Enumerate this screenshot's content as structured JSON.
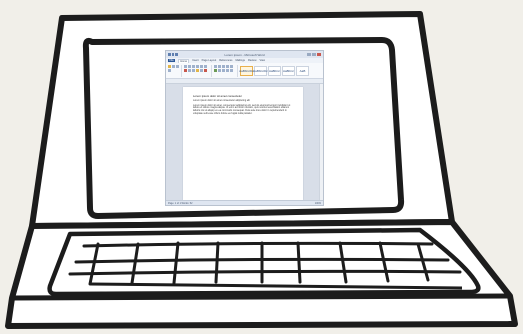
{
  "window": {
    "title": "Lorem ipsum - Microsoft Word",
    "tabs": [
      "File",
      "Home",
      "Insert",
      "Page Layout",
      "References",
      "Mailings",
      "Review",
      "View"
    ],
    "active_tab": "Home"
  },
  "ribbon": {
    "styles": [
      "AaBbCcDc",
      "AaBbCcDc",
      "AaBbCc",
      "AaBbCc",
      "AaB"
    ]
  },
  "document": {
    "heading": "Lorem ipsum dolor sit amet consectetur",
    "subheading": "Lorem ipsum dolor sit amet consectetur adipiscing elit",
    "body": "Lorem ipsum dolor sit amet, consectetur adipiscing elit, sed do eiusmod tempor incididunt ut labore et dolore magna aliqua. Ut enim ad minim veniam, quis nostrud exercitation ullamco laboris nisi ut aliquip ex ea commodo consequat. Duis aute irure dolor in reprehenderit in voluptate velit esse cillum dolore eu fugiat nulla pariatur."
  },
  "status": {
    "left": "Page: 1 of 1   Words: 52",
    "right": "100%"
  }
}
